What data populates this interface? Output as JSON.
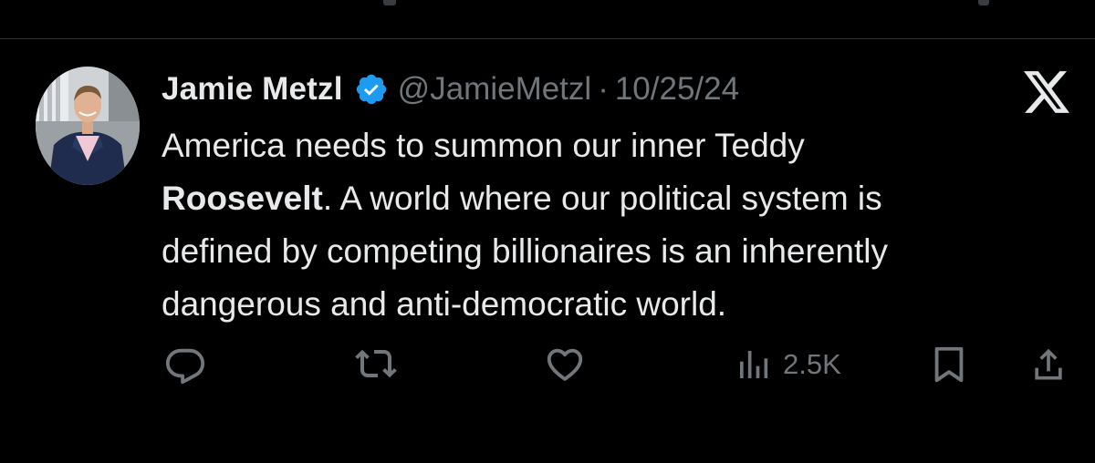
{
  "author": {
    "name": "Jamie Metzl",
    "handle": "@JamieMetzl",
    "separator": "·",
    "date": "10/25/24",
    "verified_color": "#1d9bf0"
  },
  "brand": {
    "logo_icon": "x-logo-icon"
  },
  "tweet": {
    "line1": "America needs to summon our inner Teddy",
    "bold_word": "Roosevelt",
    "line2_rest": ". A world where our political system is",
    "line3": "defined by competing billionaires is an inherently",
    "line4": "dangerous and anti-democratic world."
  },
  "actions": {
    "reply_icon": "reply-icon",
    "retweet_icon": "retweet-icon",
    "like_icon": "heart-icon",
    "views_icon": "analytics-icon",
    "views_count": "2.5K",
    "bookmark_icon": "bookmark-icon",
    "share_icon": "share-icon"
  },
  "colors": {
    "background": "#000000",
    "text_primary": "#e7e9ea",
    "text_secondary": "#71767b",
    "divider": "#2f3336"
  }
}
